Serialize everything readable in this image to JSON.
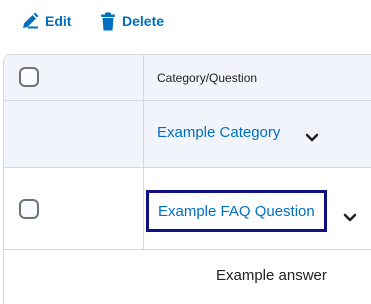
{
  "toolbar": {
    "edit_label": "Edit",
    "delete_label": "Delete",
    "edit_icon": "pencil-icon",
    "delete_icon": "trash-icon"
  },
  "table": {
    "column_header": "Category/Question",
    "category": {
      "label": "Example Category",
      "expand_icon": "chevron-down-icon"
    },
    "question": {
      "label": "Example FAQ Question",
      "expand_icon": "chevron-down-icon",
      "answer": "Example answer"
    }
  },
  "colors": {
    "link": "#006fbf",
    "focus_outline": "#0e0f80",
    "band": "#f1f5fb",
    "border": "#d3d9e3"
  }
}
